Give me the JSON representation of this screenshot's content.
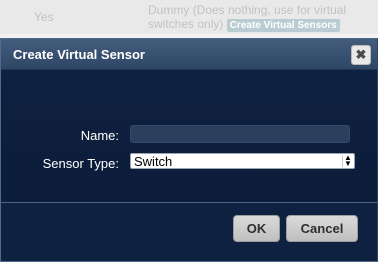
{
  "background": {
    "yes_text": "Yes",
    "description": "Dummy (Does nothing, use for virtual switches only)",
    "create_button": "Create Virtual Sensors"
  },
  "dialog": {
    "title": "Create Virtual Sensor",
    "close_icon": "close-icon",
    "close_glyph": "✖",
    "name_label": "Name:",
    "name_value": "",
    "sensor_type_label": "Sensor Type:",
    "sensor_type_value": "Switch",
    "ok_label": "OK",
    "cancel_label": "Cancel"
  },
  "colors": {
    "dialog_background": "#112441",
    "titlebar": "#3b5373",
    "button": "#cfcfcf"
  }
}
